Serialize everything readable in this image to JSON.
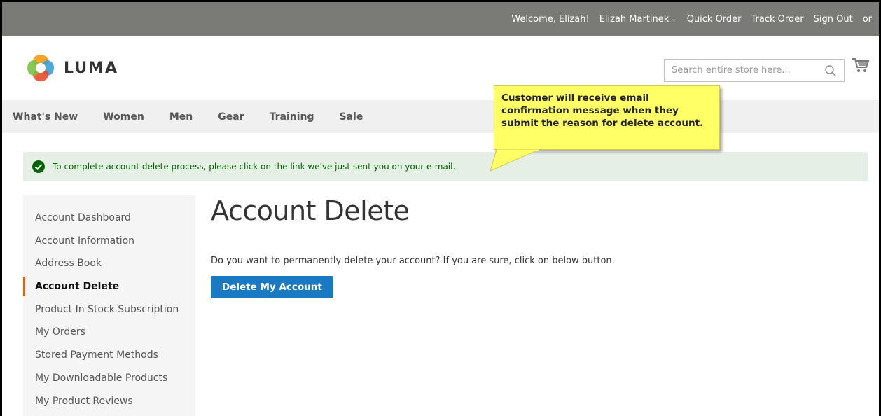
{
  "topbar": {
    "welcome": "Welcome, Elizah!",
    "user_name": "Elizah Martinek",
    "quick_order": "Quick Order",
    "track_order": "Track Order",
    "sign_out": "Sign Out",
    "or": "or"
  },
  "header": {
    "logo_text": "LUMA",
    "search_placeholder": "Search entire store here...",
    "search_value": ""
  },
  "nav": {
    "items": [
      "What's New",
      "Women",
      "Men",
      "Gear",
      "Training",
      "Sale"
    ]
  },
  "message": {
    "text": "To complete account delete process, please click on the link we've just sent you on your e-mail."
  },
  "callout": {
    "line1": "Customer will receive email",
    "line2": "confirmation message when they",
    "line3": "submit the reason for delete account."
  },
  "sidebar": {
    "items": [
      "Account Dashboard",
      "Account Information",
      "Address Book",
      "Account Delete",
      "Product In Stock Subscription",
      "My Orders",
      "Stored Payment Methods",
      "My Downloadable Products",
      "My Product Reviews"
    ],
    "active_index": 3
  },
  "main": {
    "title": "Account Delete",
    "description": "Do you want to permanently delete your account? If you are sure, click on below button.",
    "button_label": "Delete My Account"
  },
  "colors": {
    "topbar": "#7a7a76",
    "nav_bg": "#f0f0f0",
    "message_bg": "#e5efe5",
    "message_text": "#006400",
    "callout_bg": "#ffff66",
    "button_blue": "#1979c3",
    "active_marker": "#ff5501"
  }
}
